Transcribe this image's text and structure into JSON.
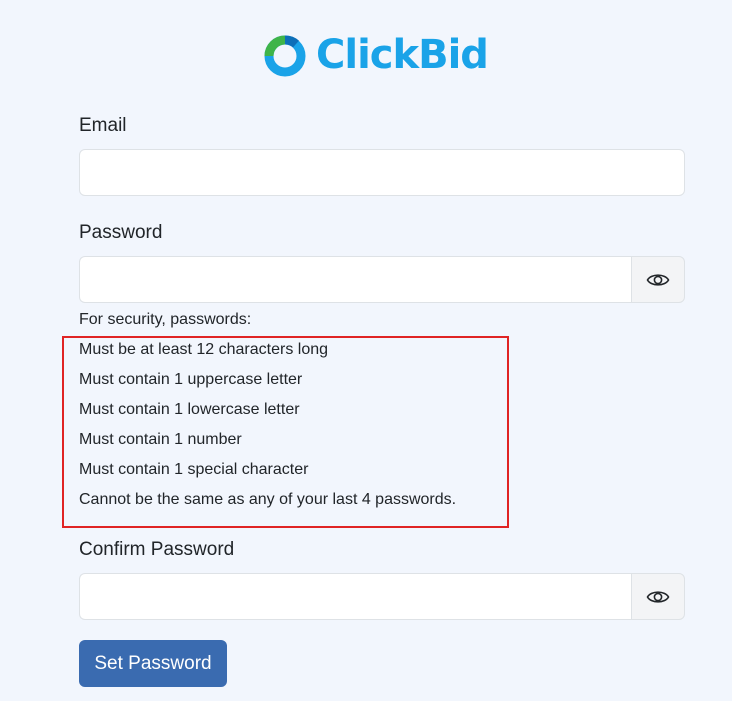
{
  "brand": {
    "name": "ClickBid"
  },
  "form": {
    "email": {
      "label": "Email",
      "value": "",
      "placeholder": ""
    },
    "password": {
      "label": "Password",
      "value": "",
      "placeholder": "",
      "toggle_icon": "eye-icon"
    },
    "requirements": {
      "intro": "For security, passwords:",
      "items": [
        "Must be at least 12 characters long",
        "Must contain 1 uppercase letter",
        "Must contain 1 lowercase letter",
        "Must contain 1 number",
        "Must contain 1 special character",
        "Cannot be the same as any of your last 4 passwords."
      ]
    },
    "confirm_password": {
      "label": "Confirm Password",
      "value": "",
      "placeholder": "",
      "toggle_icon": "eye-icon"
    },
    "submit_label": "Set Password"
  },
  "colors": {
    "background": "#f2f6fd",
    "brand_blue": "#1aa3e8",
    "brand_green": "#3fb449",
    "button": "#3a6bb0",
    "highlight_border": "#e02424"
  }
}
